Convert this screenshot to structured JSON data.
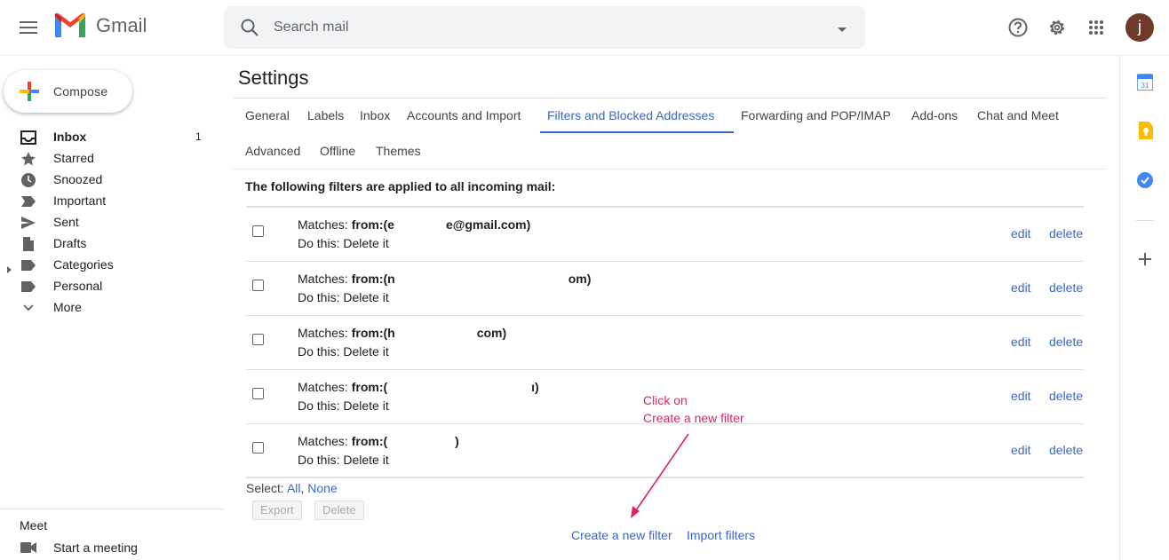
{
  "header": {
    "app_name": "Gmail",
    "search_placeholder": "Search mail",
    "avatar_letter": "j"
  },
  "sidebar": {
    "compose_label": "Compose",
    "items": [
      {
        "label": "Inbox",
        "count": "1",
        "icon": "inbox-icon",
        "active": true
      },
      {
        "label": "Starred",
        "count": "",
        "icon": "star-icon"
      },
      {
        "label": "Snoozed",
        "count": "",
        "icon": "clock-icon"
      },
      {
        "label": "Important",
        "count": "",
        "icon": "important-icon"
      },
      {
        "label": "Sent",
        "count": "",
        "icon": "send-icon"
      },
      {
        "label": "Drafts",
        "count": "",
        "icon": "draft-icon"
      },
      {
        "label": "Categories",
        "count": "",
        "icon": "label-icon"
      },
      {
        "label": "Personal",
        "count": "",
        "icon": "label-icon"
      },
      {
        "label": "More",
        "count": "",
        "icon": "chevron-down-icon"
      }
    ],
    "meet_title": "Meet",
    "meet_item": "Start a meeting"
  },
  "settings": {
    "title": "Settings",
    "tabs": [
      {
        "label": "General"
      },
      {
        "label": "Labels"
      },
      {
        "label": "Inbox"
      },
      {
        "label": "Accounts and Import"
      },
      {
        "label": "Filters and Blocked Addresses",
        "active": true
      },
      {
        "label": "Forwarding and POP/IMAP"
      },
      {
        "label": "Add-ons"
      },
      {
        "label": "Chat and Meet"
      },
      {
        "label": "Advanced"
      },
      {
        "label": "Offline"
      },
      {
        "label": "Themes"
      }
    ],
    "filters_heading": "The following filters are applied to all incoming mail:",
    "filters": [
      {
        "match_prefix": "Matches: ",
        "from_label": "from:",
        "from_value": "(e",
        "from_tail": "e@gmail.com)",
        "action": "Do this: Delete it",
        "edit": "edit",
        "delete": "delete"
      },
      {
        "match_prefix": "Matches: ",
        "from_label": "from:",
        "from_value": "(n",
        "from_tail": "om)",
        "action": "Do this: Delete it",
        "edit": "edit",
        "delete": "delete"
      },
      {
        "match_prefix": "Matches: ",
        "from_label": "from:",
        "from_value": "(h",
        "from_tail": "com)",
        "action": "Do this: Delete it",
        "edit": "edit",
        "delete": "delete"
      },
      {
        "match_prefix": "Matches: ",
        "from_label": "from:",
        "from_value": "(",
        "from_tail": "ı)",
        "action": "Do this: Delete it",
        "edit": "edit",
        "delete": "delete"
      },
      {
        "match_prefix": "Matches: ",
        "from_label": "from:",
        "from_value": "(",
        "from_tail": ")",
        "action": "Do this: Delete it",
        "edit": "edit",
        "delete": "delete"
      }
    ],
    "select_label": "Select:",
    "select_all": "All",
    "select_sep": ",",
    "select_none": "None",
    "export_button": "Export",
    "delete_button": "Delete",
    "create_filter_link": "Create a new filter",
    "import_filters_link": "Import filters"
  },
  "annotation": {
    "line1": "Click on",
    "line2": "Create a new filter",
    "color": "#e0245e"
  },
  "colors": {
    "accent": "#3c66c7",
    "avatar_bg": "#6d3a2b"
  }
}
